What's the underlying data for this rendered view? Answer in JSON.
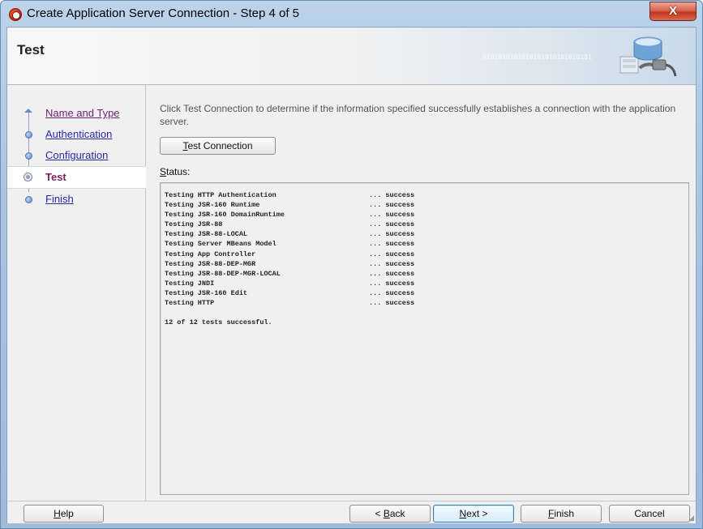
{
  "window": {
    "title": "Create Application Server Connection - Step 4 of 5",
    "close_glyph": "X"
  },
  "header": {
    "title": "Test",
    "binary_decoration": "0101010101010101010101010101"
  },
  "steps": [
    {
      "label": "Name and Type",
      "state": "visited"
    },
    {
      "label": "Authentication",
      "state": "link"
    },
    {
      "label": "Configuration",
      "state": "link"
    },
    {
      "label": "Test",
      "state": "current"
    },
    {
      "label": "Finish",
      "state": "link"
    }
  ],
  "main": {
    "instructions": "Click Test Connection to determine if the information specified successfully establishes a connection with the application server.",
    "test_button": {
      "mnemonic": "T",
      "rest": "est Connection"
    },
    "status_label": {
      "mnemonic": "S",
      "rest": "tatus:"
    },
    "log": [
      {
        "test": "Testing HTTP Authentication",
        "result": "... success"
      },
      {
        "test": "Testing JSR-160 Runtime",
        "result": "... success"
      },
      {
        "test": "Testing JSR-160 DomainRuntime",
        "result": "... success"
      },
      {
        "test": "Testing JSR-88",
        "result": "... success"
      },
      {
        "test": "Testing JSR-88-LOCAL",
        "result": "... success"
      },
      {
        "test": "Testing Server MBeans Model",
        "result": "... success"
      },
      {
        "test": "Testing App Controller",
        "result": "... success"
      },
      {
        "test": "Testing JSR-88-DEP-MGR",
        "result": "... success"
      },
      {
        "test": "Testing JSR-88-DEP-MGR-LOCAL",
        "result": "... success"
      },
      {
        "test": "Testing JNDI",
        "result": "... success"
      },
      {
        "test": "Testing JSR-160 Edit",
        "result": "... success"
      },
      {
        "test": "Testing HTTP",
        "result": "... success"
      }
    ],
    "summary": "12 of 12 tests successful."
  },
  "footer": {
    "help": {
      "mnemonic": "H",
      "rest": "elp"
    },
    "back": {
      "prefix": "< ",
      "mnemonic": "B",
      "rest": "ack"
    },
    "next": {
      "mnemonic": "N",
      "rest": "ext >"
    },
    "finish": {
      "mnemonic": "F",
      "rest": "inish"
    },
    "cancel": "Cancel"
  },
  "icons": {
    "app": "oracle-app-icon",
    "header_art": "database-plug-icon",
    "step_marker": "step-bullet-icon"
  },
  "colors": {
    "link": "#2a2aa8",
    "visited_link": "#6d1f74",
    "current_step": "#7b1f5e",
    "close_button": "#c2341e"
  }
}
